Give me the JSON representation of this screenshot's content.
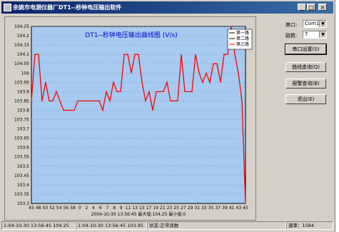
{
  "window": {
    "title": "余姚市电测仪器厂DT1--秒钟电压输出软件",
    "buttons": {
      "minimize": "_",
      "maximize": "□",
      "close": "×"
    }
  },
  "chart_data": {
    "type": "line",
    "title": "DT1--秒钟电压输出曲线图 (V/s)",
    "x": [
      "45",
      "46",
      "47",
      "48",
      "49",
      "50",
      "51",
      "52",
      "53",
      "54",
      "55",
      "56",
      "57",
      "58",
      "59",
      "0",
      "1",
      "2",
      "3",
      "4",
      "5",
      "6",
      "7",
      "8",
      "9",
      "10",
      "11",
      "12",
      "13",
      "14",
      "15",
      "16",
      "17",
      "18",
      "19",
      "20",
      "21",
      "22",
      "23",
      "24",
      "25",
      "26",
      "27",
      "28",
      "29",
      "30",
      "31",
      "32",
      "33",
      "34",
      "35",
      "36",
      "37",
      "38",
      "39",
      "40",
      "41",
      "42",
      "43",
      "44",
      "45"
    ],
    "x_tick_labels": [
      "45",
      "48",
      "50",
      "52",
      "54",
      "56",
      "58",
      "0",
      "2",
      "4",
      "6",
      "7",
      "8",
      "9",
      "11",
      "13",
      "15",
      "17",
      "19",
      "21",
      "23",
      "25",
      "27",
      "29",
      "31",
      "33",
      "35",
      "37",
      "39",
      "41",
      "43",
      "45"
    ],
    "y_tick_labels": [
      "103.3",
      "103.35",
      "103.4",
      "103.45",
      "103.5",
      "103.55",
      "103.6",
      "103.65",
      "103.7",
      "103.75",
      "103.8",
      "103.85",
      "103.9",
      "103.95",
      "104",
      "104.05",
      "104.1",
      "104.15",
      "104.2",
      "104.25"
    ],
    "ylim": [
      103.3,
      104.25
    ],
    "series": [
      {
        "name": "第三路",
        "color": "#ff0000",
        "values": [
          103.85,
          104.1,
          104.1,
          103.85,
          103.95,
          103.85,
          103.85,
          103.9,
          103.85,
          103.8,
          103.8,
          103.8,
          103.8,
          103.85,
          103.85,
          103.85,
          103.85,
          103.85,
          103.85,
          103.85,
          103.8,
          103.9,
          103.85,
          103.95,
          103.9,
          103.9,
          104.1,
          104.1,
          104.0,
          104.1,
          104.1,
          103.95,
          103.85,
          103.9,
          103.8,
          103.9,
          103.9,
          103.9,
          103.95,
          103.85,
          103.85,
          103.85,
          104.1,
          103.9,
          103.9,
          103.9,
          104.1,
          104.0,
          103.95,
          104.0,
          103.95,
          104.05,
          104.05,
          103.95,
          104.1,
          104.1,
          104.25,
          104.1,
          104.0,
          103.85,
          103.3
        ]
      }
    ],
    "legend": [
      "第一路",
      "第二路",
      "第三路"
    ],
    "legend_colors": [
      "#ffffff",
      "#ffffff",
      "#ff0000"
    ],
    "x_caption": "2004-10-30 13:56:45 最大值:104.25 最小值:0",
    "grid": true,
    "plot_bg": "#a6caf0",
    "legend_position": "top-right"
  },
  "sidebar": {
    "port_label": "串口:",
    "port_value": "Com1",
    "channel_label": "路数:",
    "channel_value": "7",
    "buttons": [
      "串口设置(S)",
      "曲线查询(Q)",
      "报警查询(B)",
      "退出(E)"
    ]
  },
  "status": {
    "panel1": "1:04-10-30 13:56:45 104.25",
    "panel2": "1:04-10-30 13:56:45 103.95",
    "panel3": "状态:正常读数",
    "panel4": "速率：1584"
  }
}
